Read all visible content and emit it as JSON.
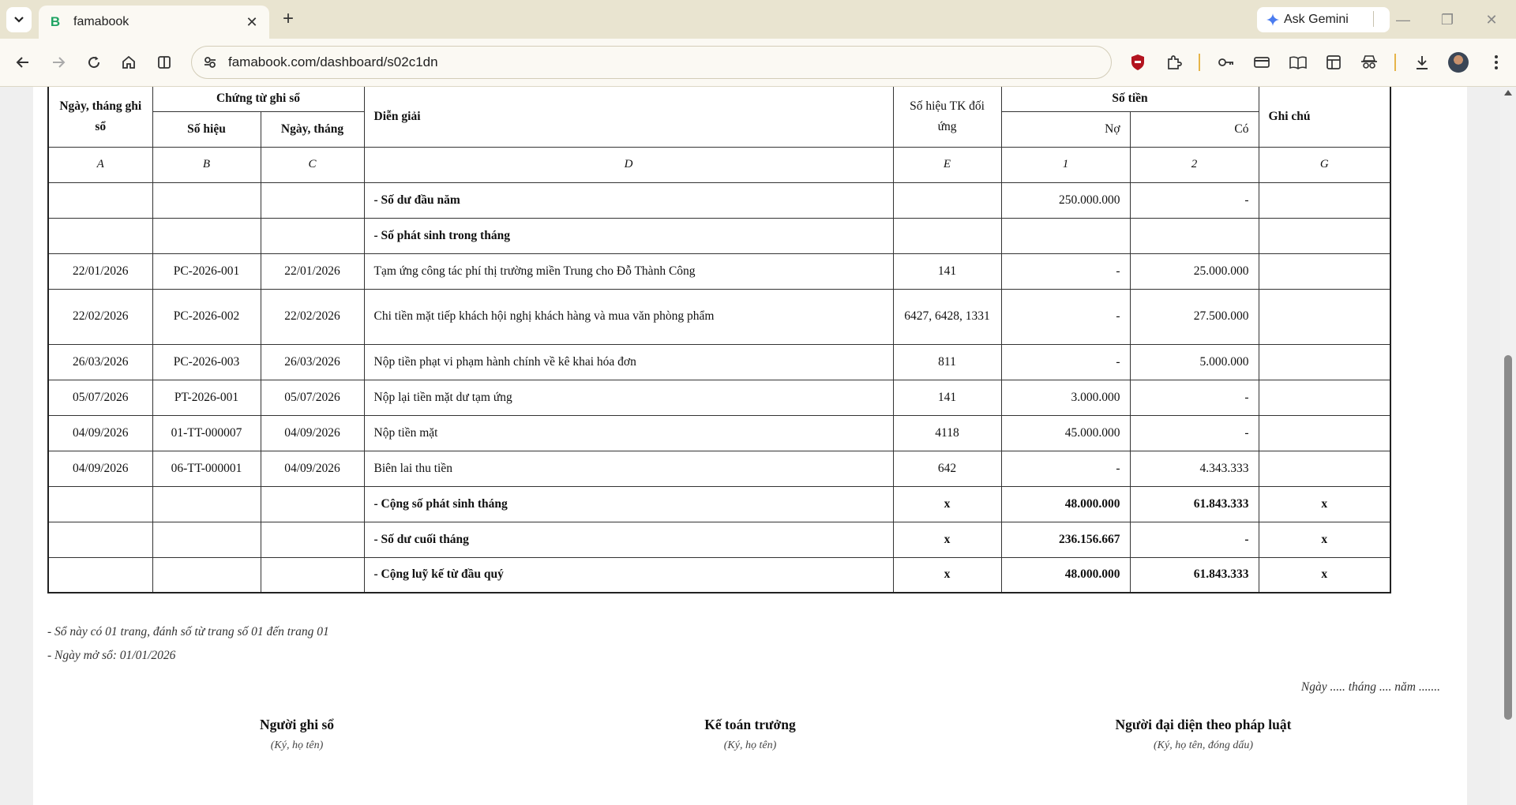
{
  "browser": {
    "tab_title": "famabook",
    "tab_favicon": "B",
    "ask_gemini": "Ask Gemini",
    "url": "famabook.com/dashboard/s02c1dn"
  },
  "ledger": {
    "headers": {
      "date_recorded": "Ngày, tháng ghi sổ",
      "voucher": "Chứng từ ghi sổ",
      "voucher_number": "Số hiệu",
      "voucher_date": "Ngày, tháng",
      "description": "Diễn giải",
      "counter_account": "Số hiệu TK đối ứng",
      "amount": "Số tiền",
      "debit": "Nợ",
      "credit": "Có",
      "note": "Ghi chú"
    },
    "column_codes": [
      "A",
      "B",
      "C",
      "D",
      "E",
      "1",
      "2",
      "G"
    ],
    "rows": [
      {
        "date": "",
        "number": "",
        "vdate": "",
        "desc": "- Số dư đầu năm",
        "acct": "",
        "debit": "250.000.000",
        "credit": "-",
        "note": "",
        "bold": true
      },
      {
        "date": "",
        "number": "",
        "vdate": "",
        "desc": "- Số phát sinh trong tháng",
        "acct": "",
        "debit": "",
        "credit": "",
        "note": "",
        "bold": true
      },
      {
        "date": "22/01/2026",
        "number": "PC-2026-001",
        "vdate": "22/01/2026",
        "desc": "Tạm ứng công tác phí thị trường miền Trung cho Đỗ Thành Công",
        "acct": "141",
        "debit": "-",
        "credit": "25.000.000",
        "note": ""
      },
      {
        "date": "22/02/2026",
        "number": "PC-2026-002",
        "vdate": "22/02/2026",
        "desc": "Chi tiền mặt tiếp khách hội nghị khách hàng và mua văn phòng phẩm",
        "acct": "6427, 6428, 1331",
        "debit": "-",
        "credit": "27.500.000",
        "note": "",
        "tall": true
      },
      {
        "date": "26/03/2026",
        "number": "PC-2026-003",
        "vdate": "26/03/2026",
        "desc": "Nộp tiền phạt vi phạm hành chính về kê khai hóa đơn",
        "acct": "811",
        "debit": "-",
        "credit": "5.000.000",
        "note": ""
      },
      {
        "date": "05/07/2026",
        "number": "PT-2026-001",
        "vdate": "05/07/2026",
        "desc": "Nộp lại tiền mặt dư tạm ứng",
        "acct": "141",
        "debit": "3.000.000",
        "credit": "-",
        "note": ""
      },
      {
        "date": "04/09/2026",
        "number": "01-TT-000007",
        "vdate": "04/09/2026",
        "desc": "Nộp tiền mặt",
        "acct": "4118",
        "debit": "45.000.000",
        "credit": "-",
        "note": ""
      },
      {
        "date": "04/09/2026",
        "number": "06-TT-000001",
        "vdate": "04/09/2026",
        "desc": "Biên lai thu tiền",
        "acct": "642",
        "debit": "-",
        "credit": "4.343.333",
        "note": ""
      },
      {
        "date": "",
        "number": "",
        "vdate": "",
        "desc": "- Cộng số phát sinh tháng",
        "acct": "x",
        "debit": "48.000.000",
        "credit": "61.843.333",
        "note": "x",
        "bold": true,
        "boldnums": true
      },
      {
        "date": "",
        "number": "",
        "vdate": "",
        "desc": "- Số dư cuối tháng",
        "acct": "x",
        "debit": "236.156.667",
        "credit": "-",
        "note": "x",
        "bold": true,
        "boldnums": true
      },
      {
        "date": "",
        "number": "",
        "vdate": "",
        "desc": "- Cộng luỹ kế từ đầu quý",
        "acct": "x",
        "debit": "48.000.000",
        "credit": "61.843.333",
        "note": "x",
        "bold": true,
        "boldnums": true
      }
    ]
  },
  "notes": {
    "pages": "- Sổ này có 01 trang, đánh số từ trang số 01 đến trang 01",
    "open_date": "- Ngày mở sổ: 01/01/2026",
    "date_line": "Ngày ..... tháng .... năm ......."
  },
  "signatures": [
    {
      "title": "Người ghi sổ",
      "sub": "(Ký, họ tên)"
    },
    {
      "title": "Kế toán trưởng",
      "sub": "(Ký, họ tên)"
    },
    {
      "title": "Người đại diện theo pháp luật",
      "sub": "(Ký, họ tên, đóng dấu)"
    }
  ]
}
